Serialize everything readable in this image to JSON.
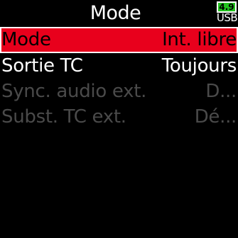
{
  "header": {
    "title": "Mode",
    "battery": {
      "level_text": "4.9",
      "source_label": "USB",
      "color": "#22c21f"
    }
  },
  "menu": {
    "items": [
      {
        "label": "Mode",
        "value": "Int. libre",
        "state": "selected"
      },
      {
        "label": "Sortie TC",
        "value": "Toujours",
        "state": "enabled"
      },
      {
        "label": "Sync. audio ext.",
        "value": "D...",
        "state": "disabled"
      },
      {
        "label": "Subst. TC ext.",
        "value": "Dé...",
        "state": "disabled"
      }
    ]
  },
  "colors": {
    "background": "#000000",
    "highlight": "#e8001c",
    "text": "#ffffff",
    "disabled_text": "#4a4a4a"
  }
}
